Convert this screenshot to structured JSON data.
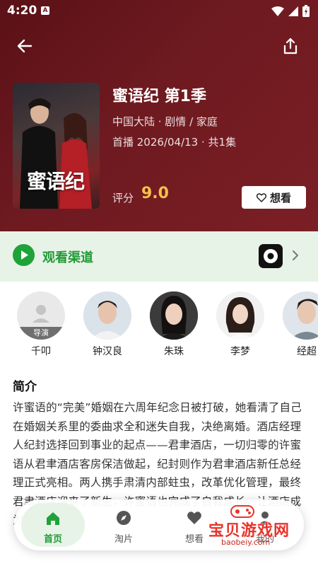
{
  "status_bar": {
    "time": "4:20",
    "notification_badge": "A"
  },
  "header": {
    "poster_text": "蜜语纪",
    "title": "蜜语纪 第1季",
    "meta": "中国大陆 · 剧情 / 家庭",
    "premiere": "首播 2026/04/13 · 共1集",
    "rating_label": "评分",
    "rating_value": "9.0",
    "want_button": "想看",
    "colors": {
      "background": "#6e1a20",
      "rating": "#f7c04a"
    }
  },
  "channel": {
    "label": "观看渠道",
    "accent": "#1fa339"
  },
  "cast": [
    {
      "name": "千叩",
      "role_tag": "导演"
    },
    {
      "name": "钟汉良",
      "role_tag": ""
    },
    {
      "name": "朱珠",
      "role_tag": ""
    },
    {
      "name": "李梦",
      "role_tag": ""
    },
    {
      "name": "经超",
      "role_tag": ""
    }
  ],
  "synopsis": {
    "title": "简介",
    "text": "许蜜语的“完美”婚姻在六周年纪念日被打破，她看清了自己在婚姻关系里的委曲求全和迷失自我，决绝离婚。酒店经理人纪封选择回到事业的起点——君聿酒店，一切归零的许蜜语从君聿酒店客房保洁做起，纪封则作为君聿酒店新任总经理正式亮相。两人携手肃清内部蛀虫，改革优化管理，最终君聿酒店迎来了新生，许蜜语也完成了自我成长，让酒店成为城市新地标。"
  },
  "bottom_nav": [
    {
      "label": "首页",
      "icon": "home-icon",
      "active": true
    },
    {
      "label": "淘片",
      "icon": "compass-icon",
      "active": false
    },
    {
      "label": "想看",
      "icon": "heart-icon",
      "active": false
    },
    {
      "label": "我的",
      "icon": "person-icon",
      "active": false
    }
  ],
  "watermark": {
    "text": "宝贝游戏网",
    "sub": "baobeiy.com"
  }
}
